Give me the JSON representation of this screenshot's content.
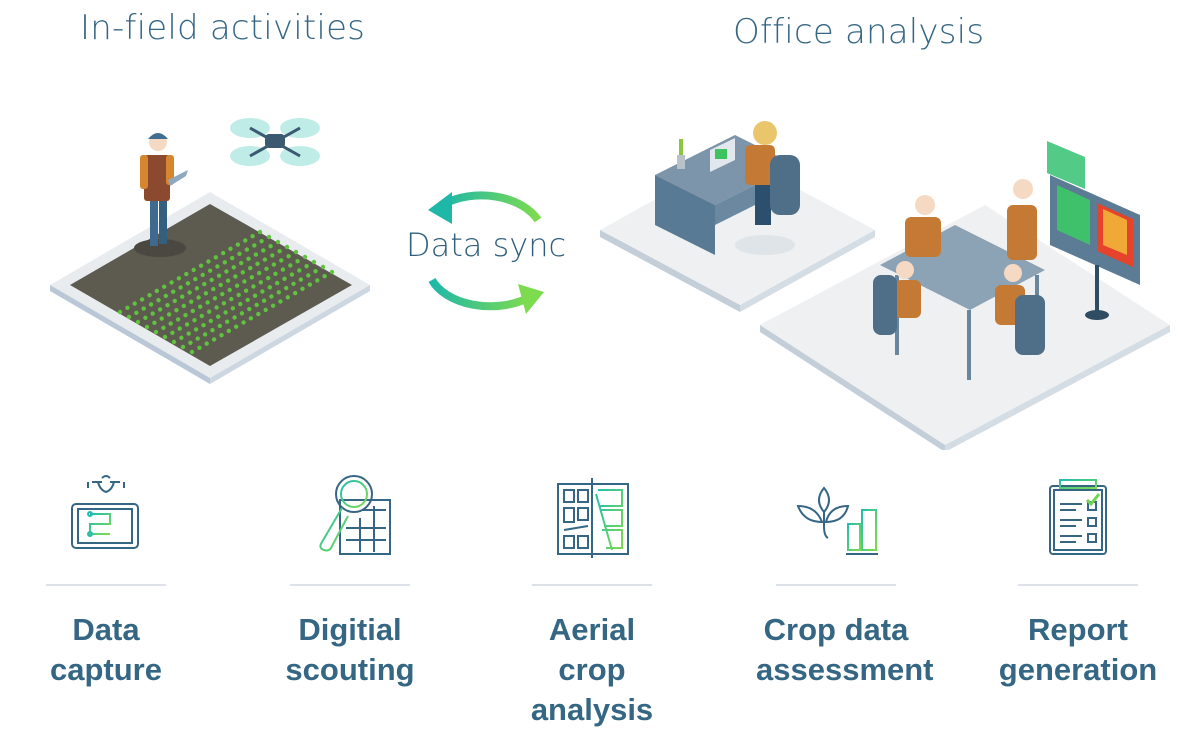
{
  "headings": {
    "field": "In-field activities",
    "office": "Office analysis"
  },
  "sync": {
    "label": "Data sync",
    "gradient_start": "#1fb8a8",
    "gradient_end": "#7ddb4f"
  },
  "colors": {
    "text": "#356784",
    "icon_stroke": "#356784",
    "accent_green": "#6fd64f",
    "accent_teal": "#22bdb0",
    "rule": "#dde2e8"
  },
  "steps": [
    {
      "line1": "Data",
      "line2": "capture",
      "icon": "tablet-drone-icon"
    },
    {
      "line1": "Digitial",
      "line2": "scouting",
      "icon": "magnifier-map-icon"
    },
    {
      "line1": "Aerial crop",
      "line2": "analysis",
      "icon": "aerial-map-icon"
    },
    {
      "line1": "Crop data",
      "line2": "assessment",
      "icon": "plant-chart-icon"
    },
    {
      "line1": "Report",
      "line2": "generation",
      "icon": "clipboard-check-icon"
    }
  ]
}
